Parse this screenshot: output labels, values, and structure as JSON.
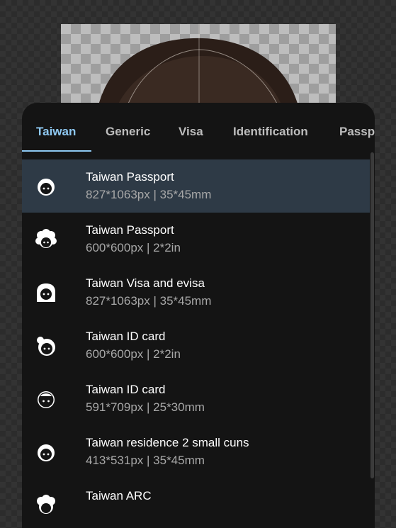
{
  "tabs": [
    {
      "label": "Taiwan",
      "active": true
    },
    {
      "label": "Generic",
      "active": false
    },
    {
      "label": "Visa",
      "active": false
    },
    {
      "label": "Identification",
      "active": false
    },
    {
      "label": "Passp",
      "active": false
    }
  ],
  "accent_color": "#8ec8f2",
  "selected_row_color": "#2e3a46",
  "items": [
    {
      "title": "Taiwan Passport",
      "subtitle": "827*1063px | 35*45mm",
      "icon": "face-short-hair-icon",
      "selected": true
    },
    {
      "title": "Taiwan Passport",
      "subtitle": "600*600px | 2*2in",
      "icon": "face-curly-hair-icon",
      "selected": false
    },
    {
      "title": "Taiwan Visa and evisa",
      "subtitle": "827*1063px | 35*45mm",
      "icon": "face-long-hair-icon",
      "selected": false
    },
    {
      "title": "Taiwan ID card",
      "subtitle": "600*600px | 2*2in",
      "icon": "face-bun-hair-icon",
      "selected": false
    },
    {
      "title": "Taiwan ID card",
      "subtitle": "591*709px | 25*30mm",
      "icon": "face-textured-hair-icon",
      "selected": false
    },
    {
      "title": "Taiwan residence 2 small cuns",
      "subtitle": "413*531px | 35*45mm",
      "icon": "face-short-hair-icon",
      "selected": false
    },
    {
      "title": "Taiwan ARC",
      "subtitle": "",
      "icon": "face-curly-hair-icon",
      "selected": false
    }
  ]
}
